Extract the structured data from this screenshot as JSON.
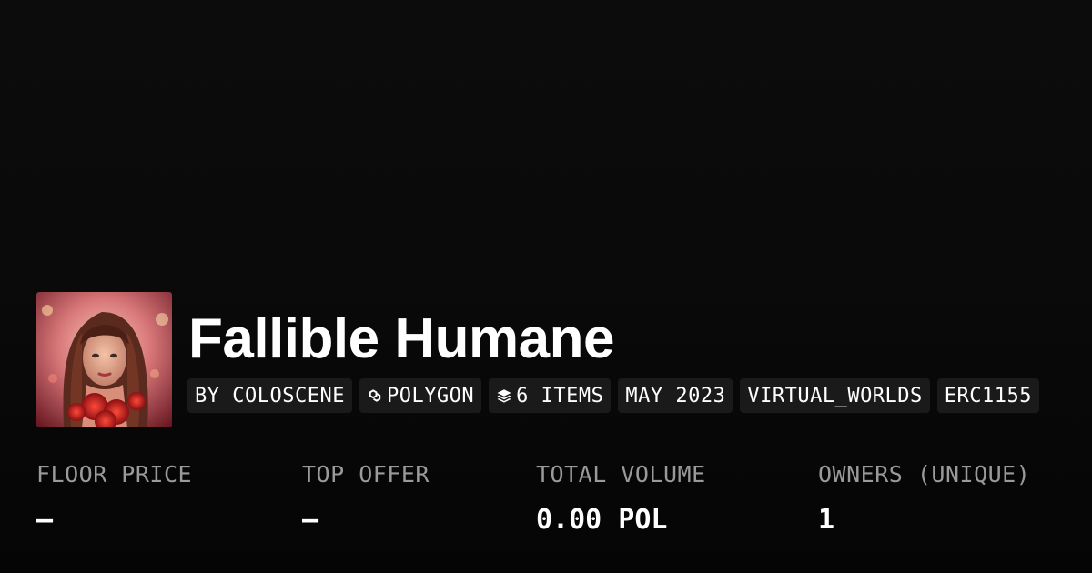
{
  "collection": {
    "title": "Fallible Humane",
    "avatar_alt": "Fallible Humane"
  },
  "tags": [
    {
      "label": "BY COLOSCENE",
      "icon": ""
    },
    {
      "label": "POLYGON",
      "icon": "polygon-icon"
    },
    {
      "label": "6 ITEMS",
      "icon": "layers-icon"
    },
    {
      "label": "MAY 2023",
      "icon": ""
    },
    {
      "label": "VIRTUAL_WORLDS",
      "icon": ""
    },
    {
      "label": "ERC1155",
      "icon": ""
    }
  ],
  "stats": [
    {
      "label": "FLOOR PRICE",
      "value": "—"
    },
    {
      "label": "TOP OFFER",
      "value": "—"
    },
    {
      "label": "TOTAL VOLUME",
      "value": "0.00 POL"
    },
    {
      "label": "OWNERS (UNIQUE)",
      "value": "1"
    }
  ],
  "colors": {
    "background": "#0a0a0a",
    "tag_background": "#1a1a1a",
    "label_gray": "#9a9a9a",
    "text": "#ffffff"
  }
}
